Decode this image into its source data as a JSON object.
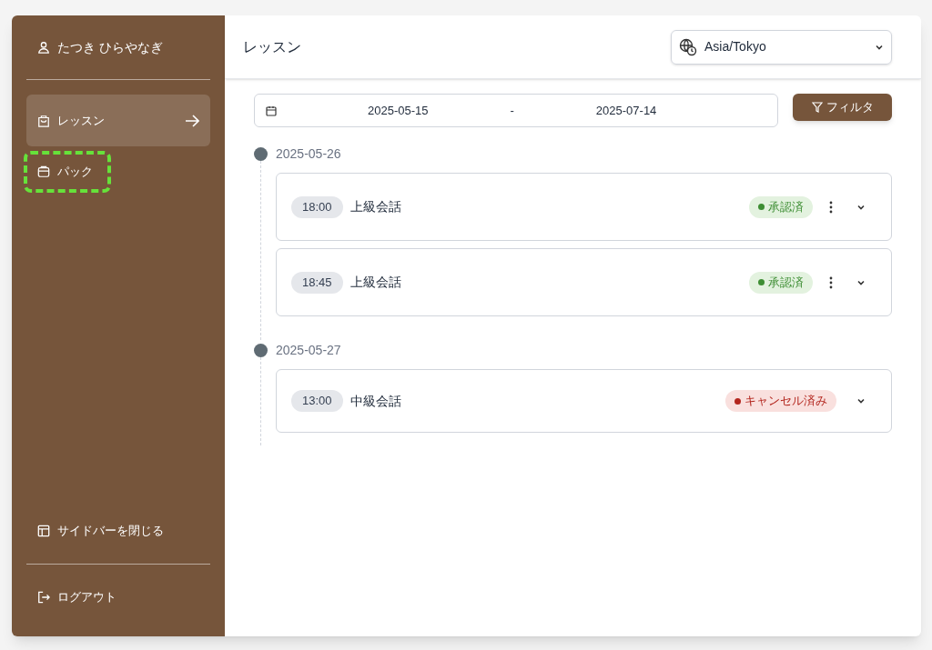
{
  "sidebar": {
    "user": "たつき ひらやなぎ",
    "items": [
      {
        "label": "レッスン",
        "kind": "bag",
        "selected": true,
        "highlighted": false
      },
      {
        "label": "パック",
        "kind": "box",
        "selected": false,
        "highlighted": true
      }
    ],
    "collapse": "サイドバーを閉じる",
    "logout": "ログアウト"
  },
  "header": {
    "title": "レッスン",
    "timezone": "Asia/Tokyo"
  },
  "date_range": {
    "start": "2025-05-15",
    "separator": "-",
    "end": "2025-07-14"
  },
  "filter_button": "フィルタ",
  "days": [
    {
      "date": "2025-05-26",
      "lessons": [
        {
          "time": "18:00",
          "title": "上級会話",
          "status": {
            "kind": "approved",
            "label": "承認済"
          },
          "has_menu": true
        },
        {
          "time": "18:45",
          "title": "上級会話",
          "status": {
            "kind": "approved",
            "label": "承認済"
          },
          "has_menu": true
        }
      ]
    },
    {
      "date": "2025-05-27",
      "lessons": [
        {
          "time": "13:00",
          "title": "中級会話",
          "status": {
            "kind": "cancelled",
            "label": "キャンセル済み"
          },
          "has_menu": false
        }
      ]
    }
  ]
}
